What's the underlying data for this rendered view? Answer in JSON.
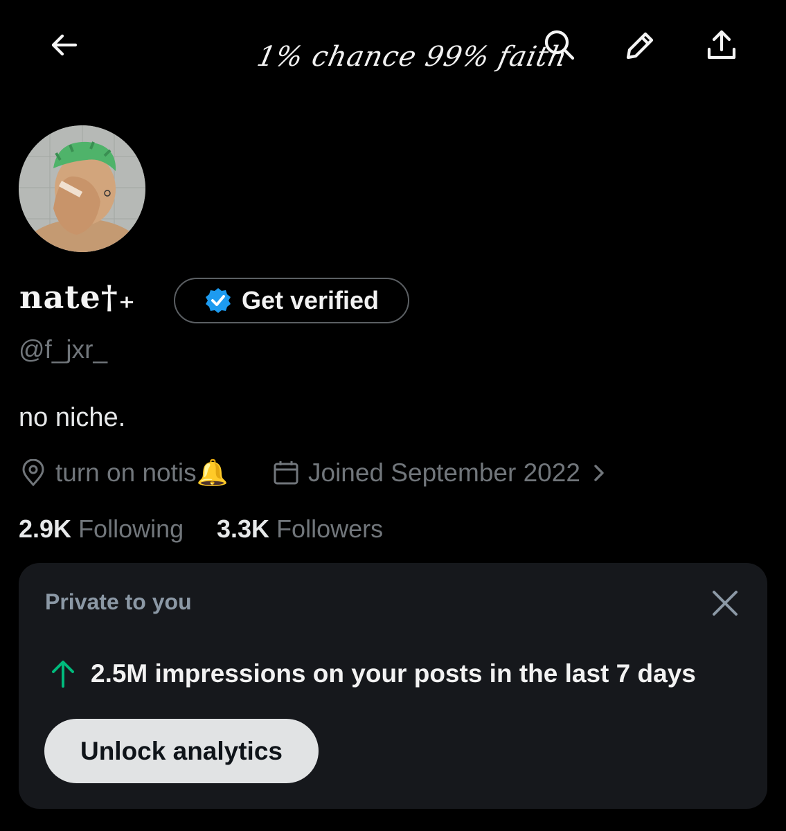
{
  "header": {
    "banner_text": "1% chance 99% faith",
    "icons": [
      "back-arrow-icon",
      "search-icon",
      "edit-icon",
      "share-icon"
    ]
  },
  "profile": {
    "display_name": "nate†₊",
    "handle": "@f_jxr_",
    "bio": "no niche.",
    "verify_button_label": "Get verified",
    "location": "turn on notis🔔",
    "joined": "Joined September 2022",
    "following_count": "2.9K",
    "following_label": "Following",
    "followers_count": "3.3K",
    "followers_label": "Followers"
  },
  "private_card": {
    "title": "Private to you",
    "impressions_text": "2.5M impressions on your posts in the last 7 days",
    "unlock_label": "Unlock analytics"
  },
  "colors": {
    "background": "#000000",
    "muted_text": "#71767b",
    "verified_blue": "#1d9bf0",
    "trend_green": "#00ba7c",
    "card_bg": "#16181c"
  }
}
